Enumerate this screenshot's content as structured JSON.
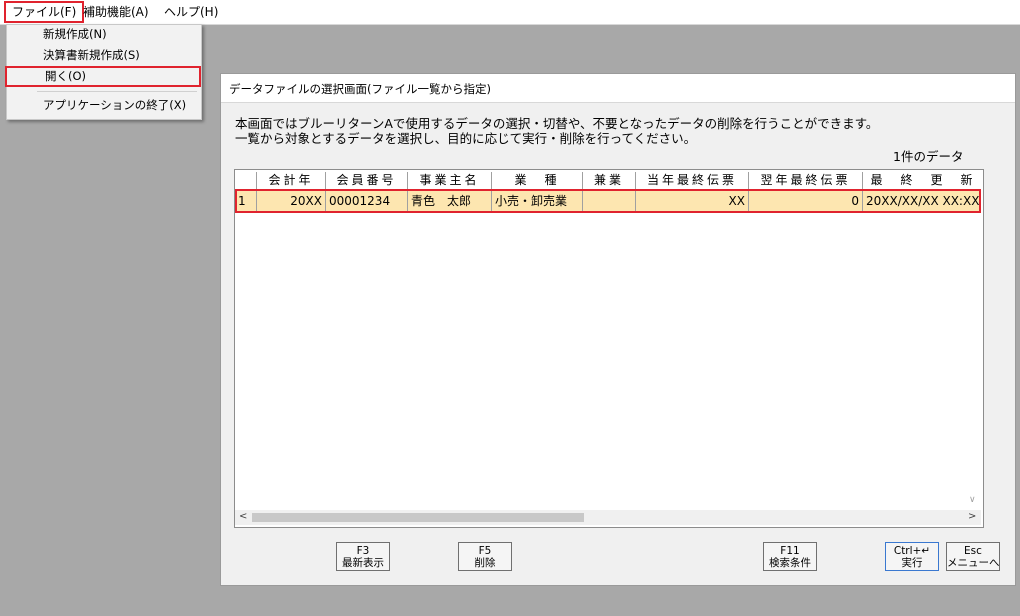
{
  "menubar": {
    "file": "ファイル(F)",
    "assist": "補助機能(A)",
    "help": "ヘルプ(H)"
  },
  "file_menu": {
    "items": [
      "新規作成(N)",
      "決算書新規作成(S)",
      "開く(O)",
      "アプリケーションの終了(X)"
    ]
  },
  "window": {
    "title": "データファイルの選択画面(ファイル一覧から指定)",
    "desc1": "本画面ではブルーリターンAで使用するデータの選択・切替や、不要となったデータの削除を行うことができます。",
    "desc2": "一覧から対象とするデータを選択し、目的に応じて実行・削除を行ってください。",
    "count": "1件のデータ"
  },
  "grid": {
    "headers": [
      "",
      "会計年",
      "会員番号",
      "事業主名",
      "業　種",
      "兼業",
      "当年最終伝票",
      "翌年最終伝票",
      "最　終　更　新"
    ],
    "rows": [
      [
        "1",
        "20XX",
        "00001234",
        "青色　太郎",
        "小売・卸売業",
        "",
        "XX",
        "0",
        "20XX/XX/XX XX:XX"
      ]
    ]
  },
  "fkeys": {
    "f3": {
      "key": "F3",
      "label": "最新表示"
    },
    "f5": {
      "key": "F5",
      "label": "削除"
    },
    "f11": {
      "key": "F11",
      "label": "検索条件"
    },
    "exec": {
      "key": "Ctrl+↵",
      "label": "実行"
    },
    "esc": {
      "key": "Esc",
      "label": "メニューへ"
    }
  },
  "colors": {
    "highlight": "#e0232e",
    "selected_row": "#fde6b0"
  }
}
